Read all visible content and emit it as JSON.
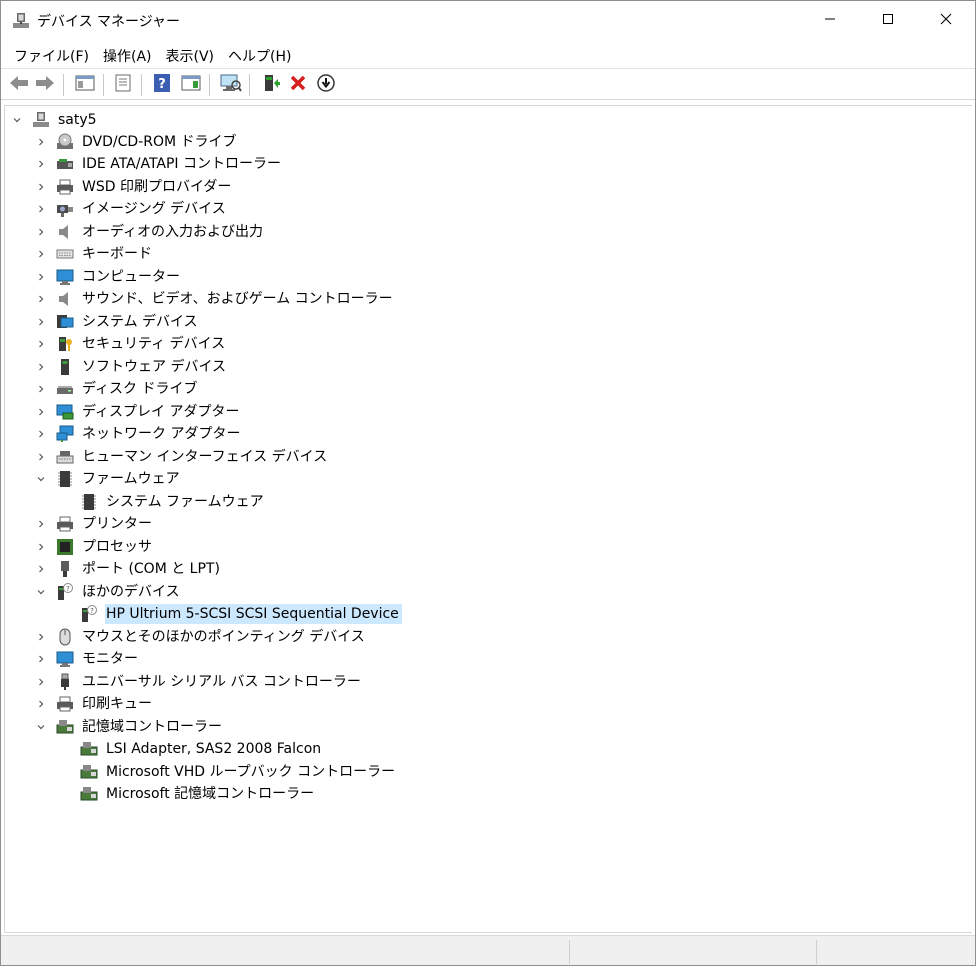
{
  "window": {
    "title": "デバイス マネージャー",
    "minimize_icon": "minimize-icon",
    "maximize_icon": "maximize-icon",
    "close_icon": "close-icon"
  },
  "menu": {
    "items": [
      "ファイル(F)",
      "操作(A)",
      "表示(V)",
      "ヘルプ(H)"
    ]
  },
  "toolbar": {
    "buttons": [
      "back-arrow-icon",
      "forward-arrow-icon",
      "show-hide-console-tree-icon",
      "properties-icon",
      "help-icon",
      "action-pane-icon",
      "scan-hardware-changes-icon",
      "update-driver-icon",
      "uninstall-device-icon",
      "disable-device-icon"
    ]
  },
  "tree": {
    "root": "saty5",
    "categories": [
      {
        "label": "DVD/CD-ROM ドライブ",
        "icon": "dvd-drive-icon",
        "expanded": false
      },
      {
        "label": "IDE ATA/ATAPI コントローラー",
        "icon": "ide-controller-icon",
        "expanded": false
      },
      {
        "label": "WSD 印刷プロバイダー",
        "icon": "printer-icon",
        "expanded": false
      },
      {
        "label": "イメージング デバイス",
        "icon": "camera-icon",
        "expanded": false
      },
      {
        "label": "オーディオの入力および出力",
        "icon": "speaker-icon",
        "expanded": false
      },
      {
        "label": "キーボード",
        "icon": "keyboard-icon",
        "expanded": false
      },
      {
        "label": "コンピューター",
        "icon": "computer-icon",
        "expanded": false
      },
      {
        "label": "サウンド、ビデオ、およびゲーム コントローラー",
        "icon": "speaker-icon",
        "expanded": false
      },
      {
        "label": "システム デバイス",
        "icon": "system-device-icon",
        "expanded": false
      },
      {
        "label": "セキュリティ デバイス",
        "icon": "security-key-icon",
        "expanded": false
      },
      {
        "label": "ソフトウェア デバイス",
        "icon": "software-device-icon",
        "expanded": false
      },
      {
        "label": "ディスク ドライブ",
        "icon": "disk-drive-icon",
        "expanded": false
      },
      {
        "label": "ディスプレイ アダプター",
        "icon": "display-adapter-icon",
        "expanded": false
      },
      {
        "label": "ネットワーク アダプター",
        "icon": "network-adapter-icon",
        "expanded": false
      },
      {
        "label": "ヒューマン インターフェイス デバイス",
        "icon": "hid-icon",
        "expanded": false
      },
      {
        "label": "ファームウェア",
        "icon": "chip-icon",
        "expanded": true,
        "children": [
          "システム ファームウェア"
        ]
      },
      {
        "label": "プリンター",
        "icon": "printer-icon",
        "expanded": false
      },
      {
        "label": "プロセッサ",
        "icon": "processor-icon",
        "expanded": false
      },
      {
        "label": "ポート (COM と LPT)",
        "icon": "port-icon",
        "expanded": false
      },
      {
        "label": "ほかのデバイス",
        "icon": "unknown-device-icon",
        "expanded": true,
        "children": [
          "HP Ultrium 5-SCSI SCSI Sequential Device"
        ]
      },
      {
        "label": "マウスとそのほかのポインティング デバイス",
        "icon": "mouse-icon",
        "expanded": false
      },
      {
        "label": "モニター",
        "icon": "monitor-icon",
        "expanded": false
      },
      {
        "label": "ユニバーサル シリアル バス コントローラー",
        "icon": "usb-icon",
        "expanded": false
      },
      {
        "label": "印刷キュー",
        "icon": "printer-icon",
        "expanded": false
      },
      {
        "label": "記憶域コントローラー",
        "icon": "storage-controller-icon",
        "expanded": true,
        "children": [
          "LSI Adapter, SAS2 2008 Falcon",
          "Microsoft VHD ループバック コントローラー",
          "Microsoft 記憶域コントローラー"
        ]
      }
    ],
    "selected": "HP Ultrium 5-SCSI SCSI Sequential Device"
  }
}
